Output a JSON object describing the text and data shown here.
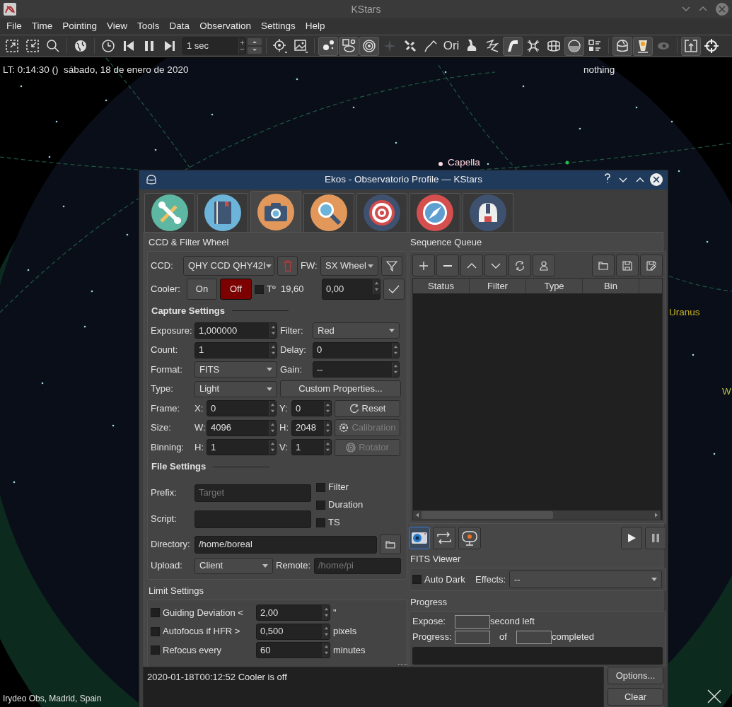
{
  "window": {
    "title": "KStars"
  },
  "menu": [
    "File",
    "Time",
    "Pointing",
    "View",
    "Tools",
    "Data",
    "Observation",
    "Settings",
    "Help"
  ],
  "toolbar": [
    {
      "kind": "action"
    },
    {
      "kind": "action"
    },
    {
      "kind": "action"
    },
    {
      "kind": "separator"
    },
    {
      "kind": "action"
    },
    {
      "kind": "separator"
    },
    {
      "kind": "action"
    },
    {
      "kind": "action"
    },
    {
      "kind": "action"
    },
    {
      "kind": "action"
    },
    {
      "kind": "spin",
      "value": "1 sec"
    },
    {
      "kind": "separator"
    },
    {
      "kind": "action"
    },
    {
      "kind": "action"
    },
    {
      "kind": "separator"
    },
    {
      "kind": "button",
      "checked": true
    },
    {
      "kind": "button",
      "checked": true
    },
    {
      "kind": "button",
      "checked": true
    },
    {
      "kind": "button",
      "checked": false
    },
    {
      "kind": "button",
      "checked": false
    },
    {
      "kind": "button",
      "checked": false
    },
    {
      "kind": "text",
      "label": "Ori",
      "checked": false
    },
    {
      "kind": "button",
      "checked": false
    },
    {
      "kind": "button",
      "checked": false
    },
    {
      "kind": "button",
      "checked": true
    },
    {
      "kind": "button",
      "checked": false
    },
    {
      "kind": "button",
      "checked": false
    },
    {
      "kind": "button",
      "checked": true
    },
    {
      "kind": "button",
      "checked": false
    },
    {
      "kind": "separator"
    },
    {
      "kind": "button",
      "checked": true
    },
    {
      "kind": "button",
      "checked": true
    },
    {
      "kind": "button",
      "checked": false
    },
    {
      "kind": "separator"
    },
    {
      "kind": "button",
      "checked": true
    },
    {
      "kind": "button",
      "checked": false
    }
  ],
  "sky": {
    "local_time": "LT: 0:14:30 ()",
    "date": "sábado, 18 de enero de 2020",
    "focus": "nothing",
    "labels": [
      {
        "text": "Capella",
        "color": "#ffd6de"
      },
      {
        "text": "Uranus",
        "color": "#c9b21e"
      },
      {
        "text": "W",
        "color": "#b3bd45"
      }
    ],
    "location": "Irydeo Obs, Madrid, Spain"
  },
  "ekos": {
    "title": "Ekos - Observatorio Profile — KStars",
    "tabs": [
      {
        "selected": false
      },
      {
        "selected": false
      },
      {
        "selected": true
      },
      {
        "selected": false
      },
      {
        "selected": false
      },
      {
        "selected": false
      },
      {
        "selected": false
      }
    ],
    "ccd_filter": {
      "title": "CCD & Filter Wheel",
      "ccd": {
        "label": "CCD:",
        "value": "QHY CCD QHY42I"
      },
      "fw": {
        "label": "FW:",
        "value": "SX Wheel"
      },
      "cooler": {
        "label": "Cooler:",
        "on": {
          "label": "On",
          "selected": false
        },
        "off": {
          "label": "Off",
          "selected": true
        },
        "temp_enabled": false,
        "temp_label": "Tº",
        "temp": "19,60",
        "target": "0,00"
      }
    },
    "capture_settings": {
      "title": "Capture Settings",
      "exposure": {
        "label": "Exposure:",
        "value": "1,000000"
      },
      "filter": {
        "label": "Filter:",
        "value": "Red"
      },
      "count": {
        "label": "Count:",
        "value": "1"
      },
      "delay": {
        "label": "Delay:",
        "value": "0"
      },
      "format": {
        "label": "Format:",
        "value": "FITS"
      },
      "gain": {
        "label": "Gain:",
        "value": "--"
      },
      "type": {
        "label": "Type:",
        "value": "Light"
      },
      "custom_properties": {
        "label": "Custom Properties..."
      },
      "frame": {
        "label": "Frame:",
        "a_label": "X:",
        "a": "0",
        "b_label": "Y:",
        "b": "0",
        "button": {
          "label": "Reset",
          "disabled": false
        }
      },
      "size": {
        "label": "Size:",
        "a_label": "W:",
        "a": "4096",
        "b_label": "H:",
        "b": "2048",
        "button": {
          "label": "Calibration",
          "disabled": true
        }
      },
      "binning": {
        "label": "Binning:",
        "a_label": "H:",
        "a": "1",
        "b_label": "V:",
        "b": "1",
        "button": {
          "label": "Rotator",
          "disabled": true
        }
      }
    },
    "file_settings": {
      "title": "File Settings",
      "prefix": {
        "label": "Prefix:",
        "placeholder": "Target"
      },
      "options": [
        {
          "label": "Filter",
          "checked": false
        },
        {
          "label": "Duration",
          "checked": false
        },
        {
          "label": "TS",
          "checked": false
        }
      ],
      "script": {
        "label": "Script:"
      },
      "directory": {
        "label": "Directory:",
        "value": "/home/boreal"
      },
      "upload": {
        "label": "Upload:",
        "value": "Client"
      },
      "remote": {
        "label": "Remote:",
        "placeholder": "/home/pi"
      }
    },
    "limit_settings": {
      "title": "Limit Settings",
      "limits": [
        {
          "label": "Guiding Deviation <",
          "checked": false,
          "value": "2,00",
          "unit": "\""
        },
        {
          "label": "Autofocus if HFR >",
          "checked": false,
          "value": "0,500",
          "unit": "pixels"
        },
        {
          "label": "Refocus every",
          "checked": false,
          "value": "60",
          "unit": "minutes"
        }
      ]
    },
    "sequence_queue": {
      "title": "Sequence Queue",
      "columns": [
        "Status",
        "Filter",
        "Type",
        "Bin"
      ]
    },
    "view_modes": [
      {
        "selected": true
      },
      {
        "selected": false
      },
      {
        "selected": false
      }
    ],
    "fits_viewer": {
      "title": "FITS Viewer",
      "auto_dark": {
        "label": "Auto Dark",
        "checked": false
      },
      "effects": {
        "label": "Effects:",
        "value": "--"
      }
    },
    "progress": {
      "title": "Progress",
      "expose_label": "Expose:",
      "expose_suffix": "second left",
      "progress_label": "Progress:",
      "of": "of",
      "completed": "completed",
      "level": 0
    },
    "log": {
      "lines": [
        "2020-01-18T00:12:52 Cooler is off"
      ],
      "buttons": [
        "Options...",
        "Clear"
      ]
    }
  }
}
